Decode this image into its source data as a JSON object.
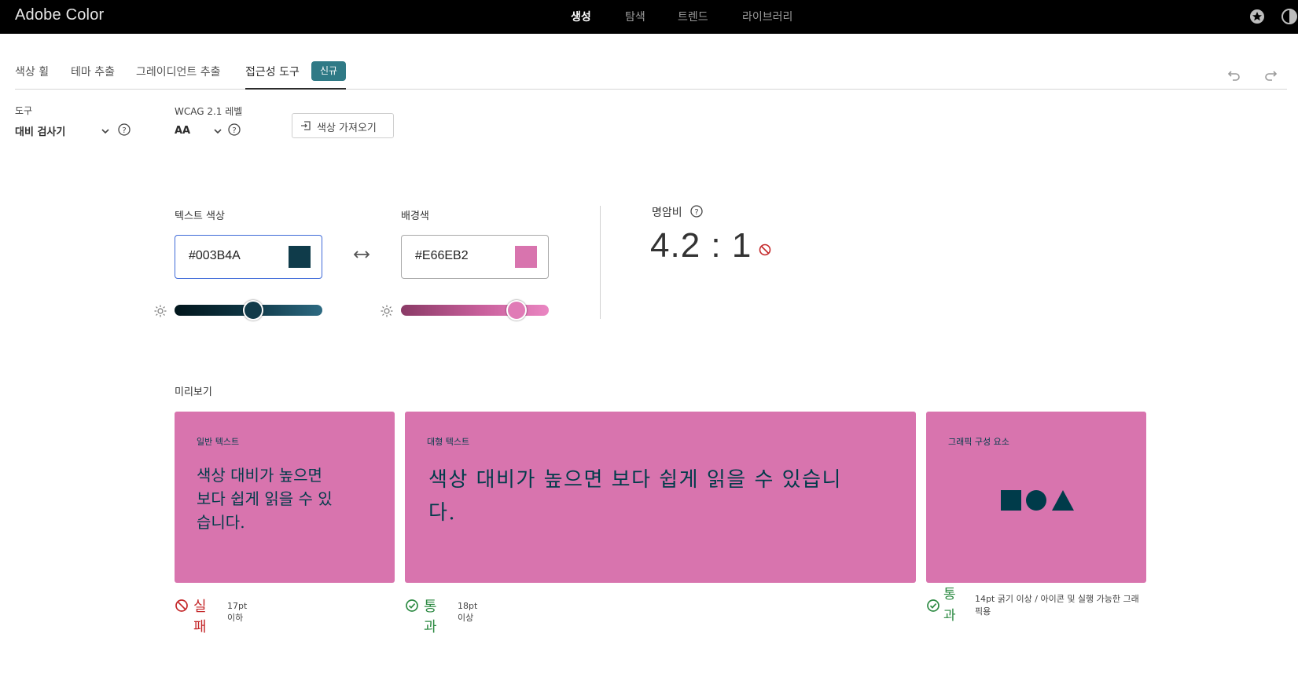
{
  "app": {
    "title": "Adobe Color",
    "nav": [
      {
        "label": "생성",
        "active": true
      },
      {
        "label": "탐색",
        "active": false
      },
      {
        "label": "트렌드",
        "active": false
      },
      {
        "label": "라이브러리",
        "active": false
      }
    ],
    "icons": [
      "star-icon",
      "theme-toggle-icon"
    ]
  },
  "subtabs": [
    {
      "label": "색상 휠",
      "active": false
    },
    {
      "label": "테마 추출",
      "active": false
    },
    {
      "label": "그레이디언트 추출",
      "active": false
    },
    {
      "label": "접근성 도구",
      "active": true
    }
  ],
  "badge_new": "신규",
  "tools": {
    "tool_label": "도구",
    "tool_value": "대비 검사기",
    "wcag_label": "WCAG 2.1 레벨",
    "wcag_value": "AA",
    "import_label": "색상 가져오기"
  },
  "text_color": {
    "label": "텍스트 색상",
    "hex": "#003B4A",
    "swatch": "#0F3B4A",
    "brightness": 0.53
  },
  "background_color": {
    "label": "배경색",
    "hex": "#E66EB2",
    "swatch": "#D874AE",
    "brightness": 0.78
  },
  "contrast": {
    "label": "명암비",
    "value": "4.2 : 1",
    "status": "fail"
  },
  "preview": {
    "label": "미리보기",
    "card_bg": "#D874AE",
    "ink": "#003B4A",
    "normal": {
      "title": "일반 텍스트",
      "line1": "색상 대비가 높으면",
      "line2": "보다 쉽게 읽을 수 있",
      "line3": "습니다.",
      "result": "실패",
      "note": "17pt 이하"
    },
    "large": {
      "title": "대형 텍스트",
      "line1": "색상 대비가 높으면 보다 쉽게 읽을 수 있습니",
      "line2": "다.",
      "result": "통과",
      "note": "18pt 이상"
    },
    "graphic": {
      "title": "그래픽 구성 요소",
      "result_line1": "통",
      "result_line2": "과",
      "note_line1": "14pt 굵기 이상 / 아이콘 및 실행 가능한 그래",
      "note_line2": "픽용"
    }
  },
  "colors": {
    "fail": "#C4282A",
    "pass": "#2D8A43",
    "accent": "#2F7A86"
  }
}
